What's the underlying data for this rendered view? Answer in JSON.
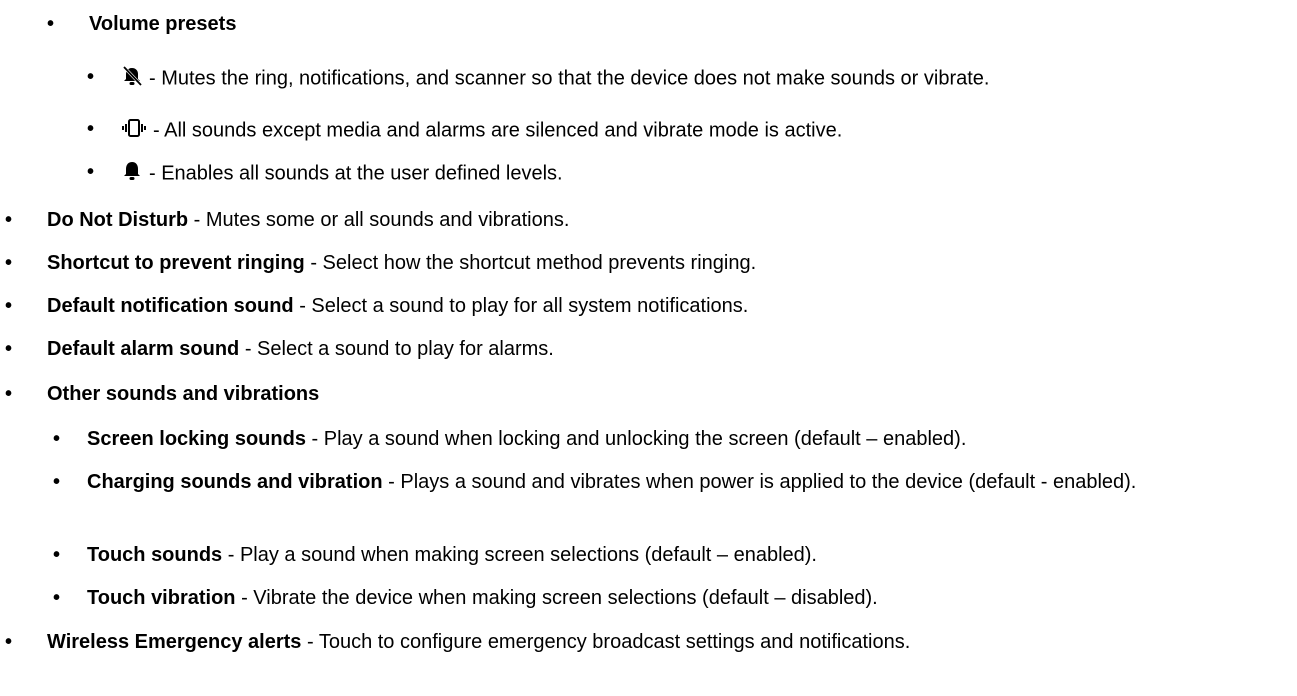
{
  "bullet": "•",
  "volume_presets": {
    "title": "Volume presets",
    "items": [
      {
        "icon": "mute-bell-icon",
        "text": "- Mutes the ring, notifications, and scanner so that the device does not make sounds or vibrate."
      },
      {
        "icon": "vibrate-icon",
        "text": "- All sounds except media and alarms are silenced and vibrate mode is active."
      },
      {
        "icon": "bell-icon",
        "text": "- Enables all sounds at the user defined levels."
      }
    ]
  },
  "items": [
    {
      "term": "Do Not Disturb",
      "desc": " - Mutes some or all sounds and vibrations."
    },
    {
      "term": "Shortcut to prevent ringing",
      "desc": " - Select how the shortcut method prevents ringing."
    },
    {
      "term": "Default notification sound",
      "desc": " - Select a sound to play for all system notifications."
    },
    {
      "term": "Default alarm sound",
      "desc": " - Select a sound to play for alarms."
    }
  ],
  "other_sounds": {
    "title": "Other sounds and vibrations",
    "items": [
      {
        "term": "Screen locking sounds",
        "desc": " - Play a sound when locking and unlocking the screen (default – enabled)."
      },
      {
        "term": "Charging sounds and vibration",
        "desc": " - Plays a sound and vibrates when power is applied to the device (default - enabled)."
      },
      {
        "term": "Touch sounds",
        "desc": " - Play a sound when making screen selections (default – enabled)."
      },
      {
        "term": "Touch vibration",
        "desc": " - Vibrate the device when making screen selections (default – disabled)."
      }
    ]
  },
  "wireless": {
    "term": "Wireless Emergency alerts",
    "desc": " - Touch to configure emergency broadcast settings and notifications."
  }
}
